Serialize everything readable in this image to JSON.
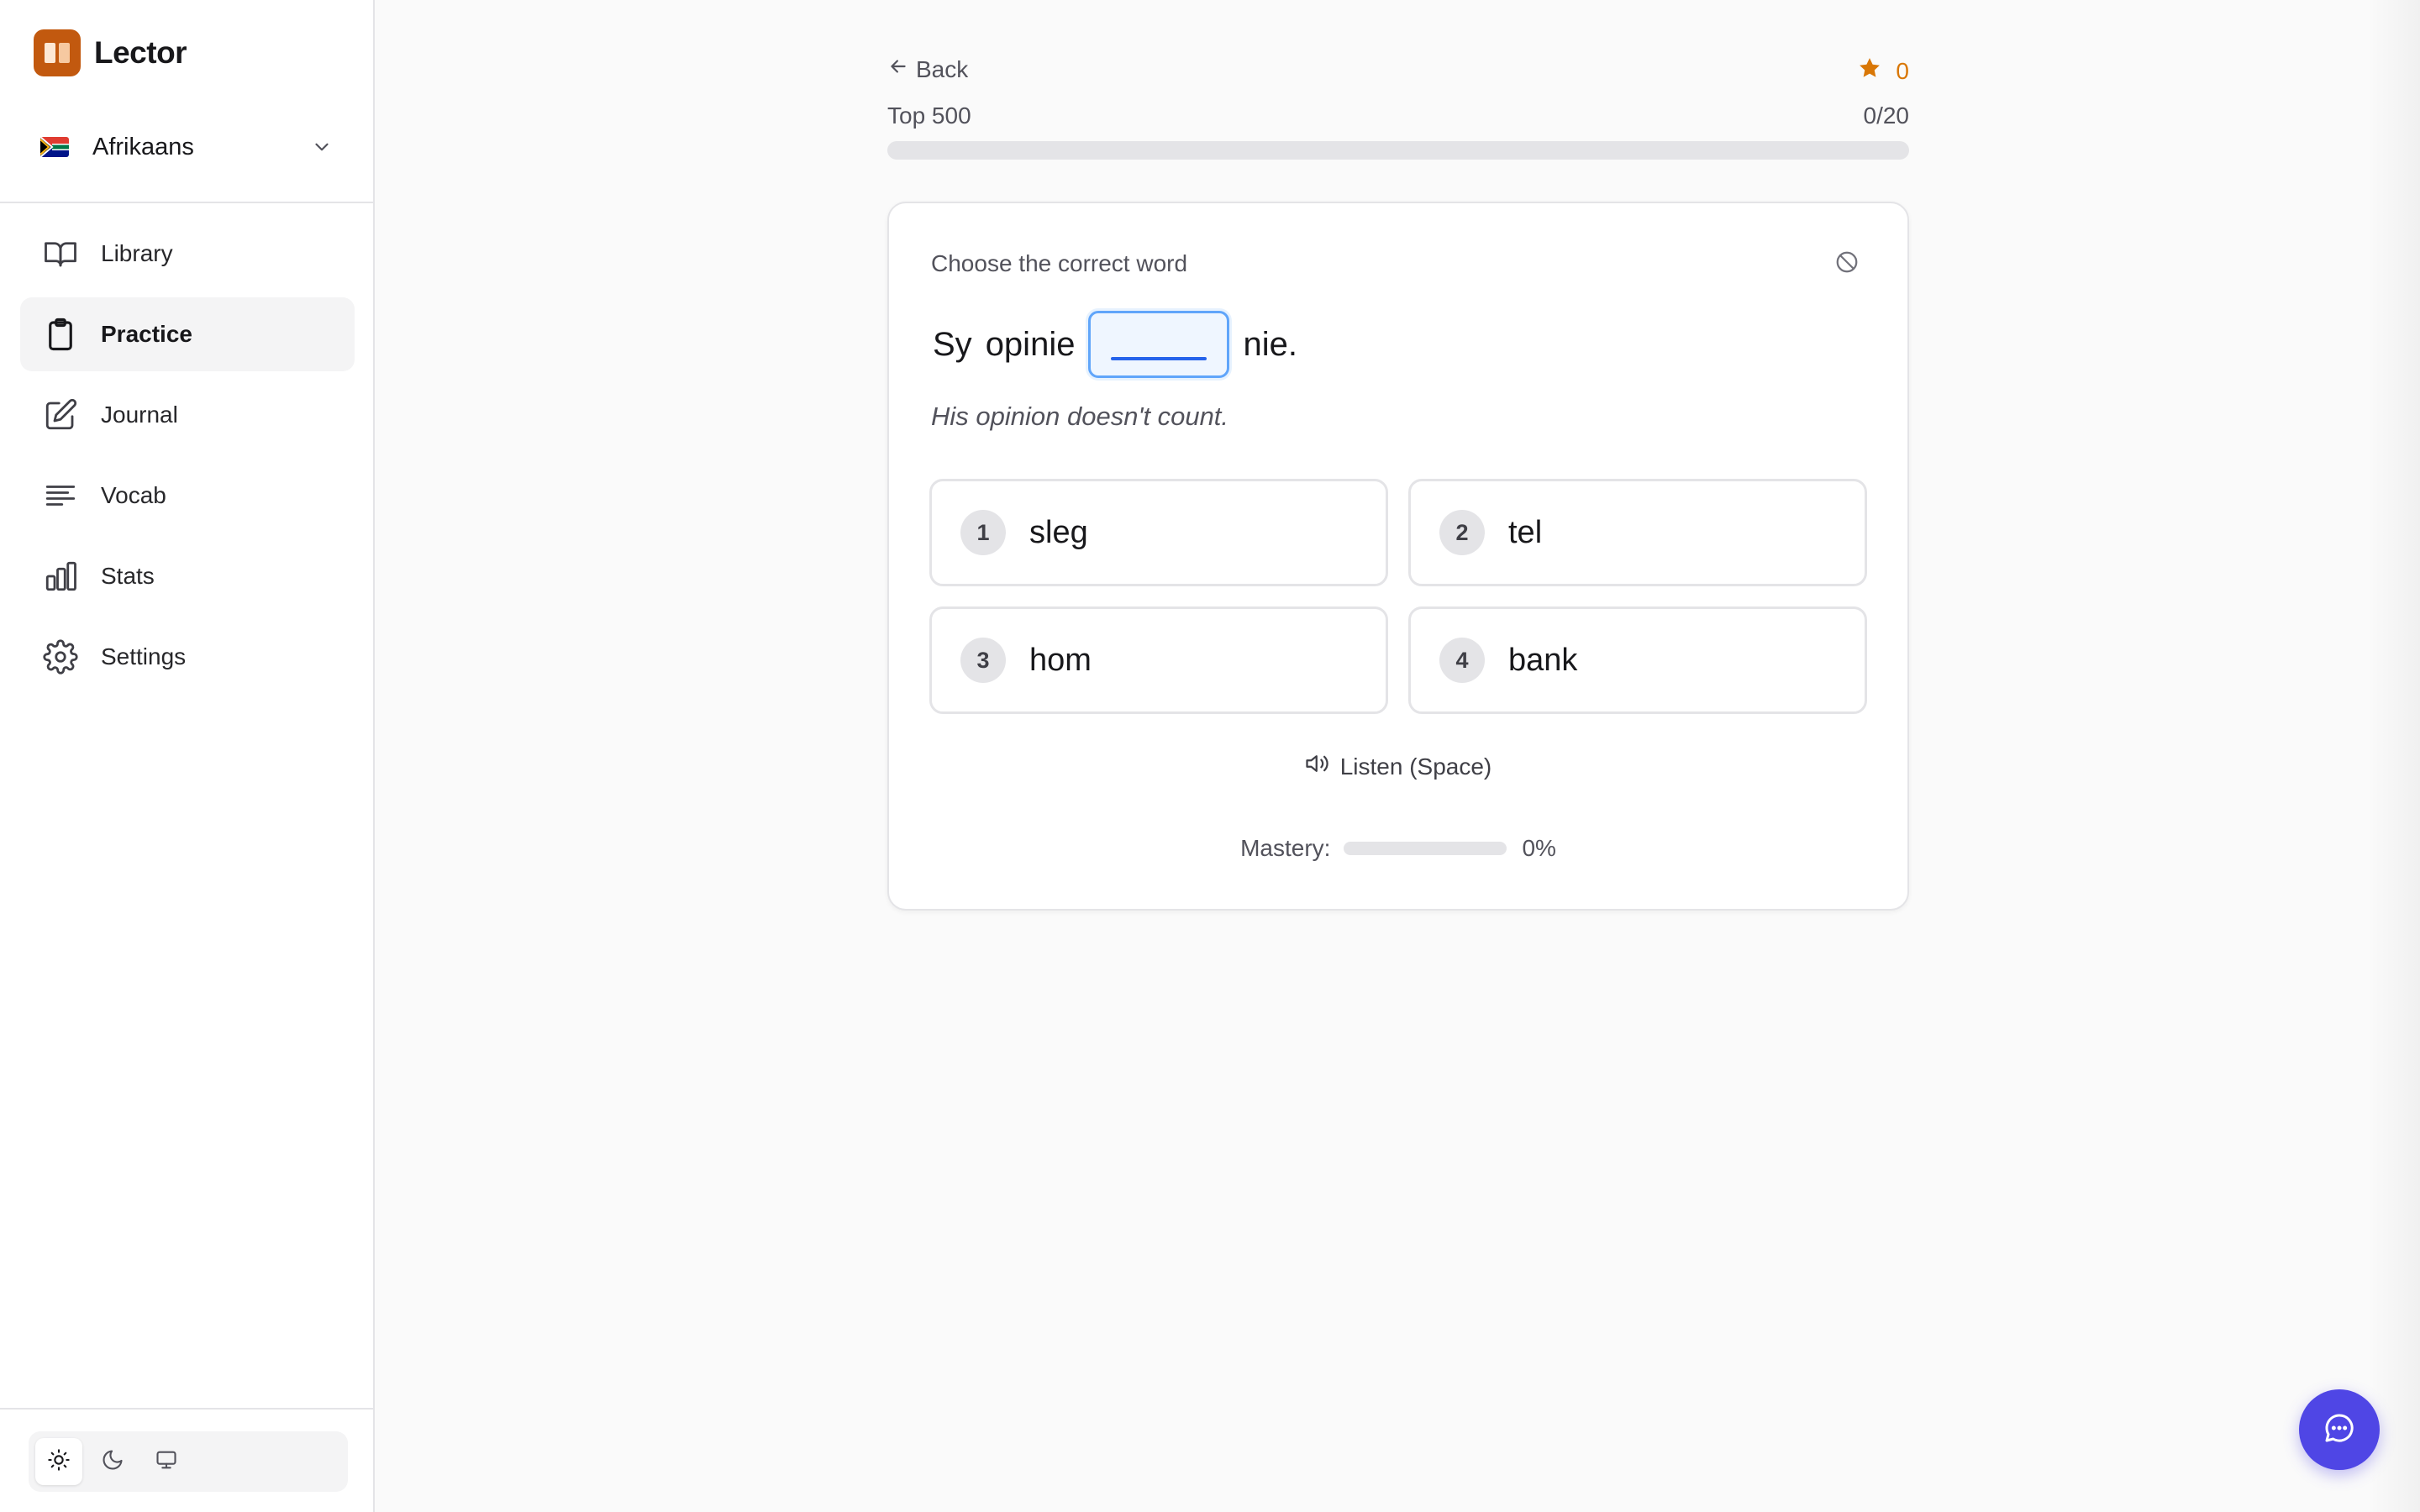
{
  "app": {
    "name": "Lector"
  },
  "language": {
    "selected": "Afrikaans"
  },
  "sidebar": {
    "items": [
      {
        "label": "Library",
        "icon": "book-icon"
      },
      {
        "label": "Practice",
        "icon": "clipboard-icon",
        "active": true
      },
      {
        "label": "Journal",
        "icon": "pencil-square-icon"
      },
      {
        "label": "Vocab",
        "icon": "lines-icon"
      },
      {
        "label": "Stats",
        "icon": "bar-chart-icon"
      },
      {
        "label": "Settings",
        "icon": "gear-icon"
      }
    ],
    "theme": {
      "selected": "light",
      "options": [
        "light",
        "dark",
        "system"
      ]
    }
  },
  "header": {
    "back_label": "Back",
    "score": "0",
    "deck_name": "Top 500",
    "progress_text": "0/20",
    "progress_fraction": 0
  },
  "exercise": {
    "prompt": "Choose the correct word",
    "sentence_before": [
      "Sy",
      "opinie"
    ],
    "sentence_after": "nie.",
    "translation": "His opinion doesn't count.",
    "options": [
      {
        "num": "1",
        "word": "sleg"
      },
      {
        "num": "2",
        "word": "tel"
      },
      {
        "num": "3",
        "word": "hom"
      },
      {
        "num": "4",
        "word": "bank"
      }
    ],
    "listen_label": "Listen (Space)",
    "mastery_label": "Mastery:",
    "mastery_value": "0%",
    "mastery_fraction": 0
  },
  "colors": {
    "brand": "#c2590f",
    "accent": "#3b82f6",
    "score": "#d97706",
    "chat_button": "#4f46e5"
  }
}
